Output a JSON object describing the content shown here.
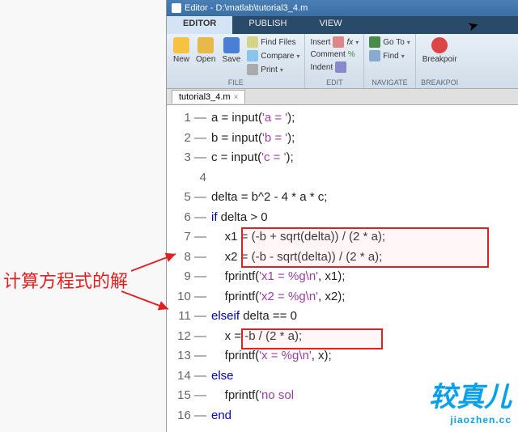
{
  "window": {
    "title": "Editor - D:\\matlab\\tutorial3_4.m"
  },
  "tabs": {
    "editor": "EDITOR",
    "publish": "PUBLISH",
    "view": "VIEW"
  },
  "ribbon": {
    "new": "New",
    "open": "Open",
    "save": "Save",
    "findfiles": "Find Files",
    "compare": "Compare",
    "print": "Print",
    "comment": "Comment",
    "insert": "Insert",
    "indent": "Indent",
    "goto": "Go To",
    "find": "Find",
    "breakpoints": "Breakpoir",
    "group_file": "FILE",
    "group_edit": "EDIT",
    "group_nav": "NAVIGATE",
    "group_bp": "BREAKPOI"
  },
  "filetab": {
    "name": "tutorial3_4.m",
    "close": "×"
  },
  "code": {
    "lines": [
      {
        "n": "1 —",
        "pre": "",
        "t": "a = input(",
        "s": "'a = '",
        "r": ");"
      },
      {
        "n": "2 —",
        "pre": "",
        "t": "b = input(",
        "s": "'b = '",
        "r": ");"
      },
      {
        "n": "3 —",
        "pre": "",
        "t": "c = input(",
        "s": "'c = '",
        "r": ");"
      },
      {
        "n": "4",
        "pre": "",
        "t": "",
        "s": "",
        "r": ""
      },
      {
        "n": "5 —",
        "pre": "",
        "t": "delta = b^2 - 4 * a * c;",
        "s": "",
        "r": ""
      },
      {
        "n": "6 —",
        "pre": "",
        "kw": "if",
        "t": " delta > 0",
        "s": "",
        "r": ""
      },
      {
        "n": "7 —",
        "pre": "    ",
        "t": "x1 = (-b + sqrt(delta)) / (2 * a);",
        "s": "",
        "r": ""
      },
      {
        "n": "8 —",
        "pre": "    ",
        "t": "x2 = (-b - sqrt(delta)) / (2 * a);",
        "s": "",
        "r": ""
      },
      {
        "n": "9 —",
        "pre": "    ",
        "t": "fprintf(",
        "s": "'x1 = %g\\n'",
        "r": ", x1);"
      },
      {
        "n": "10 —",
        "pre": "    ",
        "t": "fprintf(",
        "s": "'x2 = %g\\n'",
        "r": ", x2);"
      },
      {
        "n": "11 —",
        "pre": "",
        "kw": "elseif",
        "t": " delta == 0",
        "s": "",
        "r": ""
      },
      {
        "n": "12 —",
        "pre": "    ",
        "t": "x = -b / (2 * a);",
        "s": "",
        "r": ""
      },
      {
        "n": "13 —",
        "pre": "    ",
        "t": "fprintf(",
        "s": "'x = %g\\n'",
        "r": ", x);"
      },
      {
        "n": "14 —",
        "pre": "",
        "kw": "else",
        "t": "",
        "s": "",
        "r": ""
      },
      {
        "n": "15 —",
        "pre": "    ",
        "t": "fprintf(",
        "s": "'no sol",
        "r": ""
      },
      {
        "n": "16 —",
        "pre": "",
        "kw": "end",
        "t": "",
        "s": "",
        "r": ""
      }
    ]
  },
  "annotation": {
    "text": "计算方程式的解"
  },
  "watermark": {
    "big": "较真儿",
    "small": "jiaozhen.cc"
  },
  "colors": {
    "new_icon": "#f5c242",
    "open_icon": "#e8b84a",
    "save_icon": "#4a7fd4",
    "breakpoint_icon": "#d44"
  }
}
